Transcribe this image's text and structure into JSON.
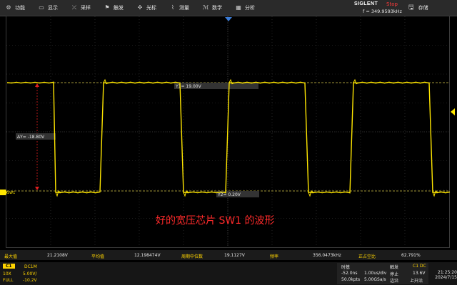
{
  "menu": [
    {
      "label": "功能",
      "icon": "gear-icon",
      "glyph": "⚙"
    },
    {
      "label": "显示",
      "icon": "display-icon",
      "glyph": "▭"
    },
    {
      "label": "采样",
      "icon": "sample-icon",
      "glyph": "⤫"
    },
    {
      "label": "触发",
      "icon": "trigger-icon",
      "glyph": "⚑"
    },
    {
      "label": "光标",
      "icon": "cursor-icon",
      "glyph": "✣"
    },
    {
      "label": "测量",
      "icon": "measure-icon",
      "glyph": "⌇"
    },
    {
      "label": "数学",
      "icon": "math-icon",
      "glyph": "ℳ"
    },
    {
      "label": "分析",
      "icon": "analysis-icon",
      "glyph": "▦"
    }
  ],
  "brand": {
    "logo": "SIGLENT",
    "state": "Stop",
    "freq": "f = 349.9593kHz"
  },
  "save": {
    "label": "存储",
    "icon": "save-icon",
    "glyph": "🖫"
  },
  "screen": {
    "trace_color": "#ffe600",
    "cursor_color": "#e02020",
    "y1_label": "Y1= 19.00V",
    "y2_label": "Y2= 0.20V",
    "dy_label": "ΔY= -18.80V",
    "channel_marker": "SW1",
    "annotation": "好的宽压芯片 SW1 的波形"
  },
  "measurements": [
    {
      "label": "最大值",
      "value": "21.2108V"
    },
    {
      "label": "平均值",
      "value": "12.198474V"
    },
    {
      "label": "周期中位数",
      "value": "19.1127V"
    },
    {
      "label": "频率",
      "value": "356.0473kHz"
    },
    {
      "label": "正占空比",
      "value": "62.791%"
    }
  ],
  "channel": {
    "name": "C1",
    "coupling": "DC1M",
    "probe": "10X",
    "scale": "5.00V/",
    "bw": "FULL",
    "offset": "-10.2V"
  },
  "timebase": {
    "title": "时基",
    "delay": "-52.0ns",
    "scale": "1.00us/div",
    "mem": "50.0kpts",
    "rate": "5.00GSa/s"
  },
  "trigger": {
    "title": "触发",
    "source": "C1 DC",
    "mode": "停止",
    "level": "13.6V",
    "edge_label": "边沿",
    "slope": "上升沿"
  },
  "clock": {
    "time": "21:25:20",
    "date": "2024/7/15"
  }
}
